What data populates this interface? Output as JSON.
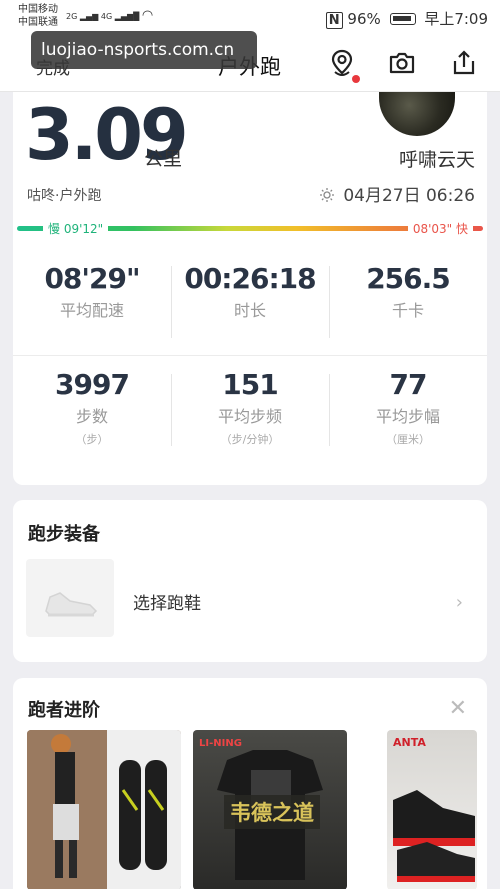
{
  "status_bar": {
    "carrier1": "中国移动",
    "carrier2": "中国联通",
    "net1": "2G",
    "net2": "4G",
    "battery": "96%",
    "time": "早上7:09"
  },
  "header": {
    "done_label": "完成",
    "title": "户外跑",
    "icons": [
      "location-pin-icon",
      "camera-icon",
      "share-icon"
    ]
  },
  "watermark": "luojiao-nsports.com.cn",
  "summary": {
    "distance": "3.09",
    "distance_unit": "公里",
    "username": "呼啸云天",
    "sport_type": "咕咚·户外跑",
    "date_time": "04月27日 06:26"
  },
  "pace_scale": {
    "slow_label": "慢 09'12\"",
    "fast_label": "08'03\" 快"
  },
  "stats_row1": [
    {
      "value": "08'29\"",
      "label": "平均配速"
    },
    {
      "value": "00:26:18",
      "label": "时长"
    },
    {
      "value": "256.5",
      "label": "千卡"
    }
  ],
  "stats_row2": [
    {
      "value": "3997",
      "label": "步数",
      "unit": "（步）"
    },
    {
      "value": "151",
      "label": "平均步频",
      "unit": "（步/分钟）"
    },
    {
      "value": "77",
      "label": "平均步幅",
      "unit": "（厘米）"
    }
  ],
  "gear": {
    "title": "跑步装备",
    "select_label": "选择跑鞋"
  },
  "advanced": {
    "title": "跑者进阶",
    "ad_text": "韦德之道",
    "brand_lining": "LI-NING",
    "brand_anta": "ANTA"
  },
  "colors": {
    "accent_dark": "#253040",
    "pace_slow": "#1fb37a",
    "pace_fast": "#e9544a",
    "notification_dot": "#e8383d"
  }
}
